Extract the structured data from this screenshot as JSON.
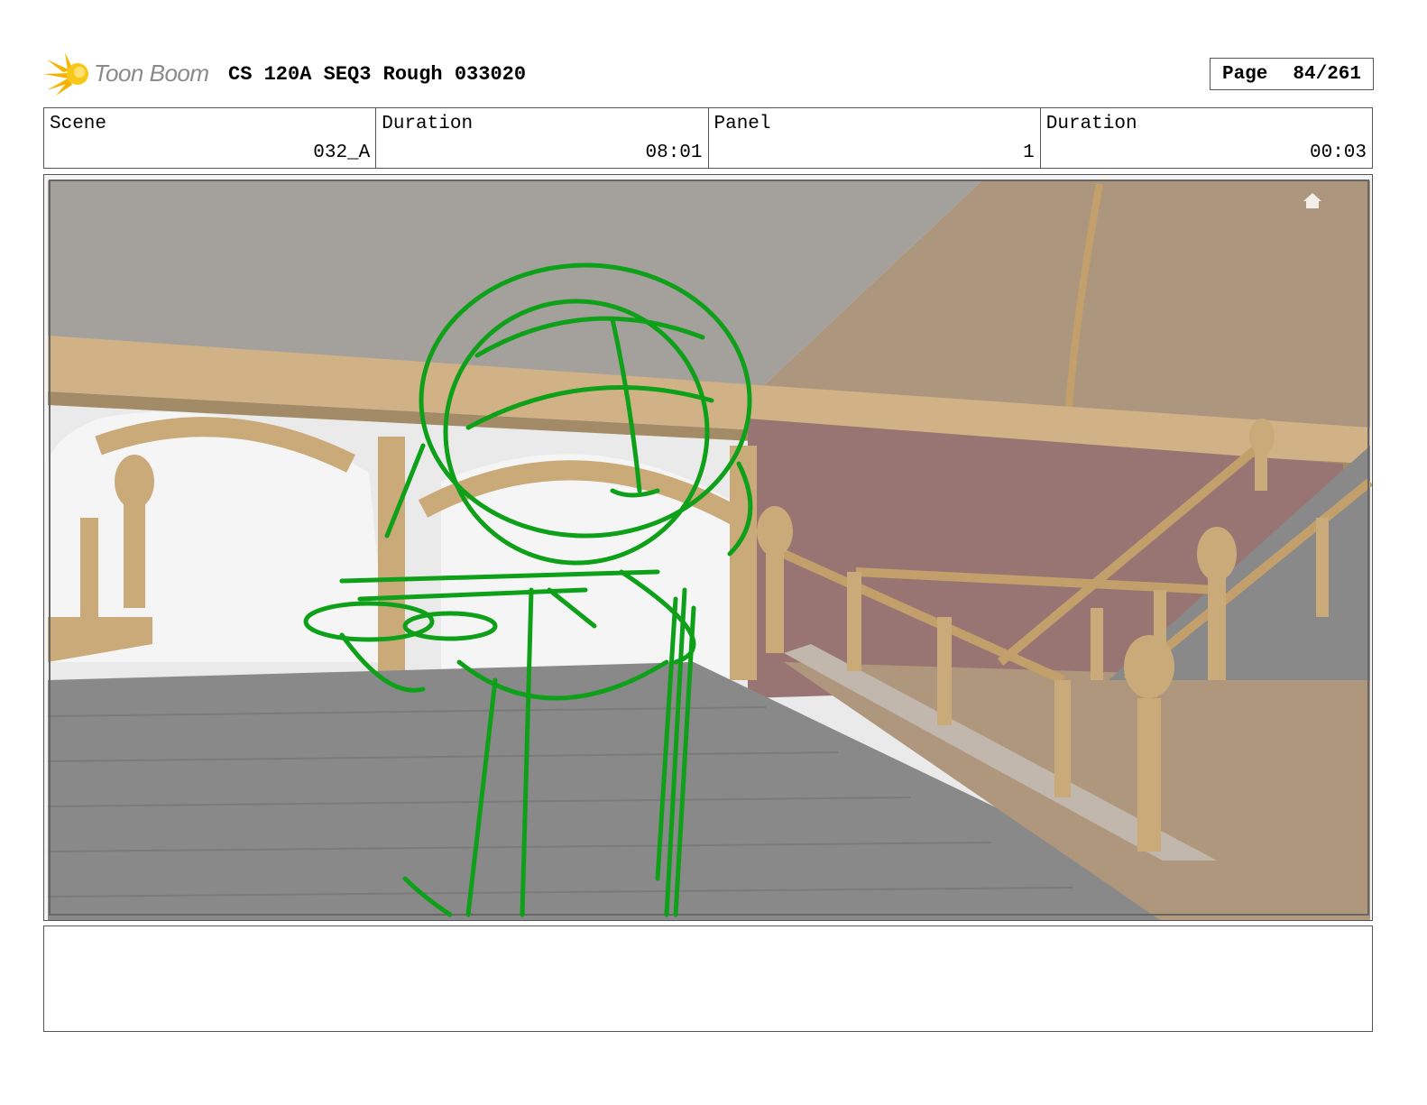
{
  "header": {
    "logo_text": "Toon Boom",
    "title": "CS 120A SEQ3 Rough 033020",
    "page_label": "Page",
    "page_value": "84/261"
  },
  "info": {
    "scene_label": "Scene",
    "scene_value": "032_A",
    "scene_duration_label": "Duration",
    "scene_duration_value": "08:01",
    "panel_label": "Panel",
    "panel_value": "1",
    "panel_duration_label": "Duration",
    "panel_duration_value": "00:03"
  },
  "panel_image": {
    "sketch_color": "#0fa01a",
    "railing_color": "#c9a36a",
    "curtain_color": "#9b6e6a",
    "stairs_color": "#808080"
  },
  "notes": {
    "text": ""
  }
}
